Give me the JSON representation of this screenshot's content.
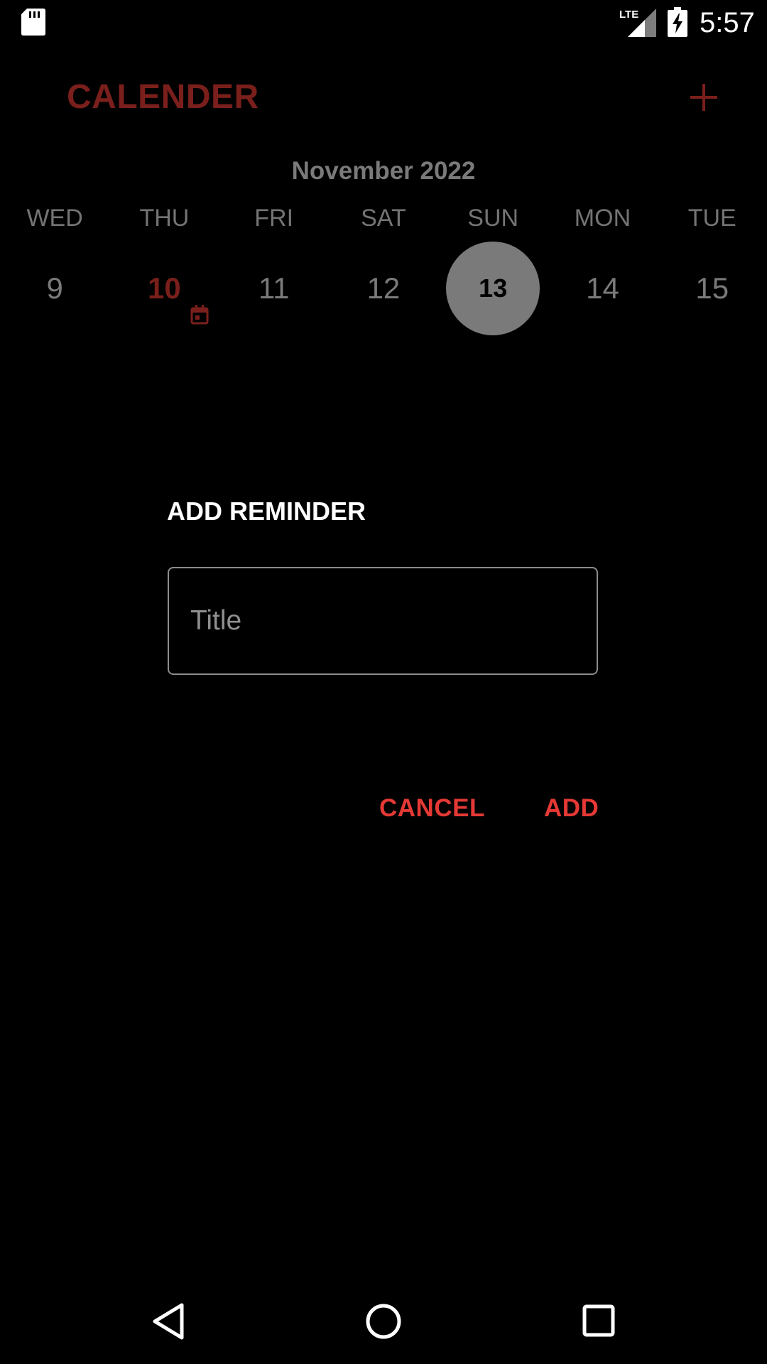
{
  "status_bar": {
    "time": "5:57",
    "network": "LTE",
    "icons": [
      "sd-card-icon",
      "lte-signal-icon",
      "battery-charging-icon"
    ]
  },
  "app_bar": {
    "title": "CALENDER",
    "add_icon": "plus-icon"
  },
  "calendar": {
    "month": "November 2022",
    "weekdays": [
      "WED",
      "THU",
      "FRI",
      "SAT",
      "SUN",
      "MON",
      "TUE"
    ],
    "dates": [
      "9",
      "10",
      "11",
      "12",
      "13",
      "14",
      "15"
    ],
    "today": "10",
    "selected": "13",
    "event_marker_on": "10"
  },
  "dialog": {
    "title": "ADD REMINDER",
    "input_placeholder": "Title",
    "input_value": "",
    "cancel_label": "CANCEL",
    "add_label": "ADD"
  },
  "colors": {
    "background": "#000000",
    "brand_dim": "#7a1f1b",
    "accent": "#e53935",
    "muted": "#7a7a7a"
  },
  "nav_bar": {
    "icons": [
      "back-icon",
      "home-icon",
      "recents-icon"
    ]
  }
}
